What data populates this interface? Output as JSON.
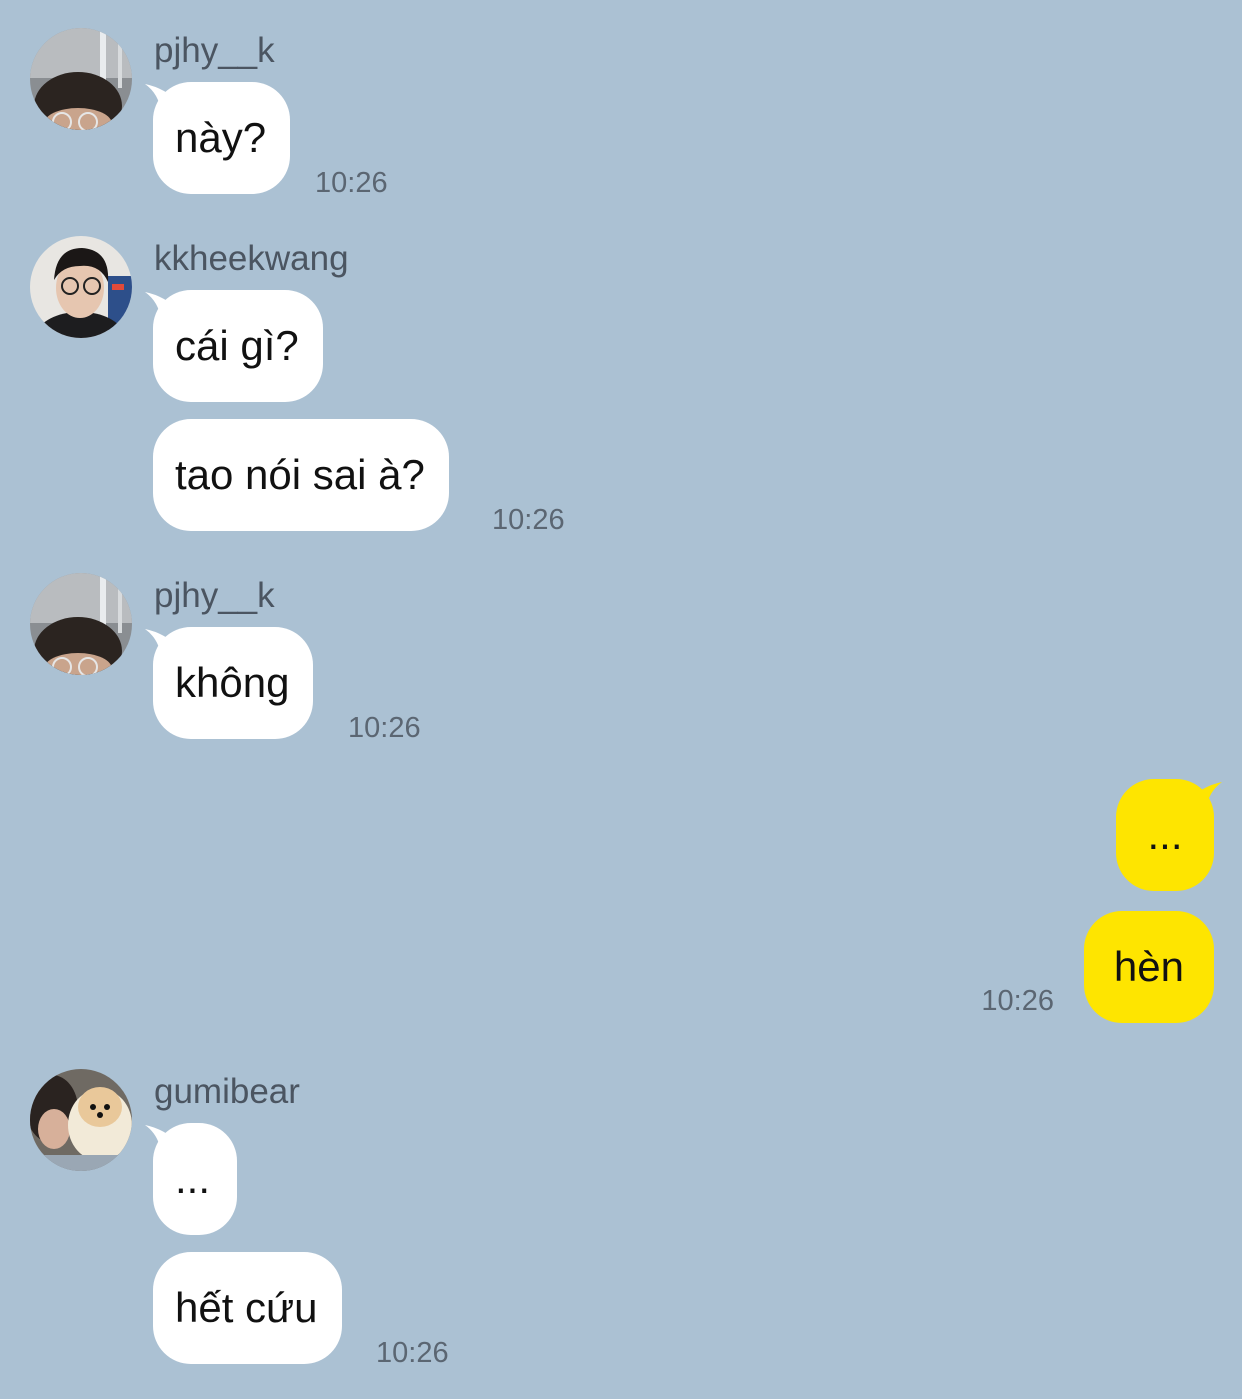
{
  "colors": {
    "background": "#abc1d3",
    "incoming_bubble": "#ffffff",
    "outgoing_bubble": "#fee500",
    "sender_name": "#4b5561",
    "timestamp": "#5b6672"
  },
  "messages": [
    {
      "sender": "pjhy__k",
      "avatar": "avatar-pjhy-icon",
      "bubbles": [
        "này?"
      ],
      "time": "10:26"
    },
    {
      "sender": "kkheekwang",
      "avatar": "avatar-kkheekwang-icon",
      "bubbles": [
        "cái gì?",
        "tao nói sai à?"
      ],
      "time": "10:26"
    },
    {
      "sender": "pjhy__k",
      "avatar": "avatar-pjhy-icon",
      "bubbles": [
        "không"
      ],
      "time": "10:26"
    },
    {
      "sender": "me",
      "outgoing": true,
      "bubbles": [
        "...",
        "hèn"
      ],
      "time": "10:26"
    },
    {
      "sender": "gumibear",
      "avatar": "avatar-gumibear-icon",
      "bubbles": [
        "...",
        "hết cứu"
      ],
      "time": "10:26"
    }
  ]
}
